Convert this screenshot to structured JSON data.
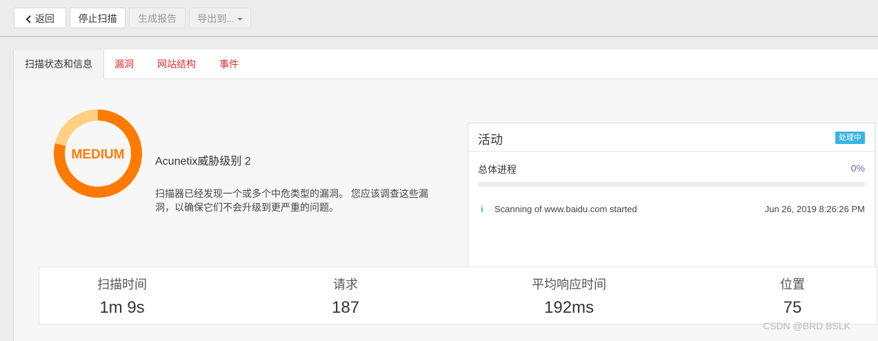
{
  "toolbar": {
    "back_label": "返回",
    "stop_label": "停止扫描",
    "report_label": "生成报告",
    "export_label": "导出到..."
  },
  "tabs": [
    {
      "label": "扫描状态和信息",
      "active": true
    },
    {
      "label": "漏洞",
      "active": false
    },
    {
      "label": "网站结构",
      "active": false
    },
    {
      "label": "事件",
      "active": false
    }
  ],
  "threat": {
    "gauge_label": "MEDIUM",
    "title": "Acunetix威胁级别 2",
    "description": "扫描器已经发现一个或多个中危类型的漏洞。 您应该调查这些漏洞，以确保它们不会升级到更严重的问题。",
    "colors": {
      "ring": "#ff7a00",
      "ring_light": "#ffd082",
      "text": "#ff7a00"
    }
  },
  "activity": {
    "title": "活动",
    "badge": "处理中",
    "progress_label": "总体进程",
    "progress_value": "0%",
    "progress_fraction": 0,
    "events": [
      {
        "icon": "info-icon",
        "message": "Scanning of www.baidu.com started",
        "time": "Jun 26, 2019 8:26:26 PM"
      }
    ]
  },
  "stats": [
    {
      "label": "扫描时间",
      "value": "1m 9s"
    },
    {
      "label": "请求",
      "value": "187"
    },
    {
      "label": "平均响应时间",
      "value": "192ms"
    },
    {
      "label": "位置",
      "value": "75"
    }
  ],
  "watermark": "CSDN @BRD BSLK"
}
